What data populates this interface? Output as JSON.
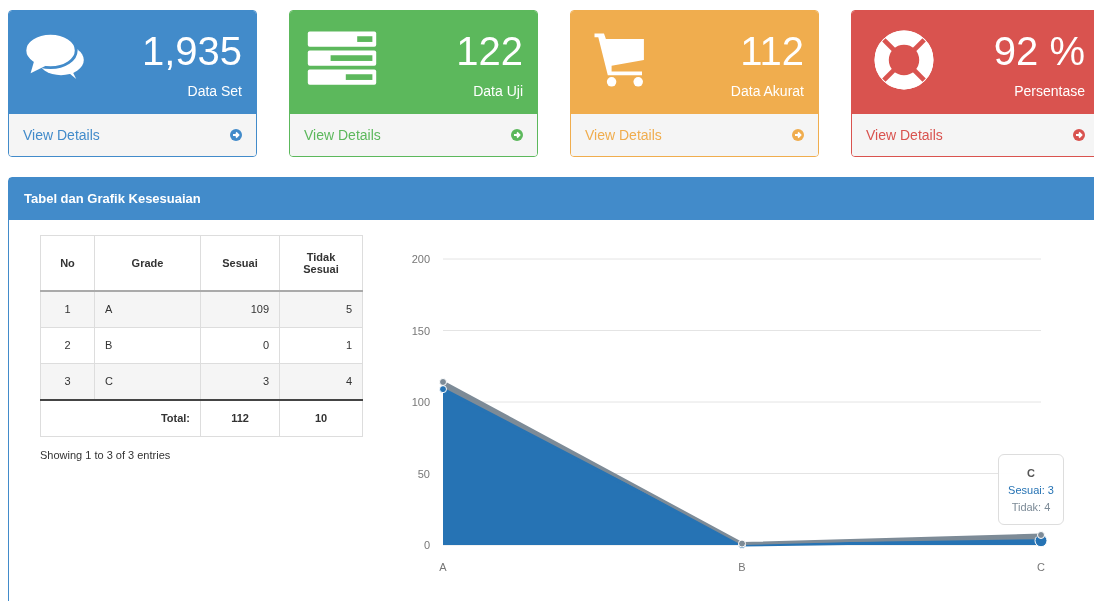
{
  "cards": [
    {
      "kind": "comments",
      "color": "#428bca",
      "value": "1,935",
      "label": "Data Set",
      "link": "View Details"
    },
    {
      "kind": "server",
      "color": "#5cb85c",
      "value": "122",
      "label": "Data Uji",
      "link": "View Details"
    },
    {
      "kind": "cart",
      "color": "#f0ad4e",
      "value": "112",
      "label": "Data Akurat",
      "link": "View Details"
    },
    {
      "kind": "lifebuoy",
      "color": "#d9534f",
      "value": "92 %",
      "label": "Persentase",
      "link": "View Details"
    }
  ],
  "panel": {
    "title": "Tabel dan Grafik Kesesuaian",
    "table": {
      "columns": [
        "No",
        "Grade",
        "Sesuai",
        "Tidak Sesuai"
      ],
      "rows": [
        [
          "1",
          "A",
          "109",
          "5"
        ],
        [
          "2",
          "B",
          "0",
          "1"
        ],
        [
          "3",
          "C",
          "3",
          "4"
        ]
      ],
      "total": {
        "label": "Total:",
        "sesuai": "112",
        "tidak": "10"
      }
    },
    "info": "Showing 1 to 3 of 3 entries",
    "chart_data": {
      "type": "area",
      "stacked": true,
      "grid": true,
      "categories": [
        "A",
        "B",
        "C"
      ],
      "yticks": [
        0,
        50,
        100,
        150,
        200
      ],
      "ylim": [
        0,
        200
      ],
      "series": [
        {
          "color": "#2673b4",
          "values": [
            109,
            0,
            3
          ]
        },
        {
          "color": "#7d8b97",
          "values": [
            5,
            1,
            4
          ]
        }
      ]
    },
    "tooltip": {
      "title": "C",
      "lines": [
        {
          "text": "Sesuai: 3",
          "color": "#2673b4"
        },
        {
          "text": "Tidak: 4",
          "color": "#7d8b97"
        }
      ]
    }
  }
}
